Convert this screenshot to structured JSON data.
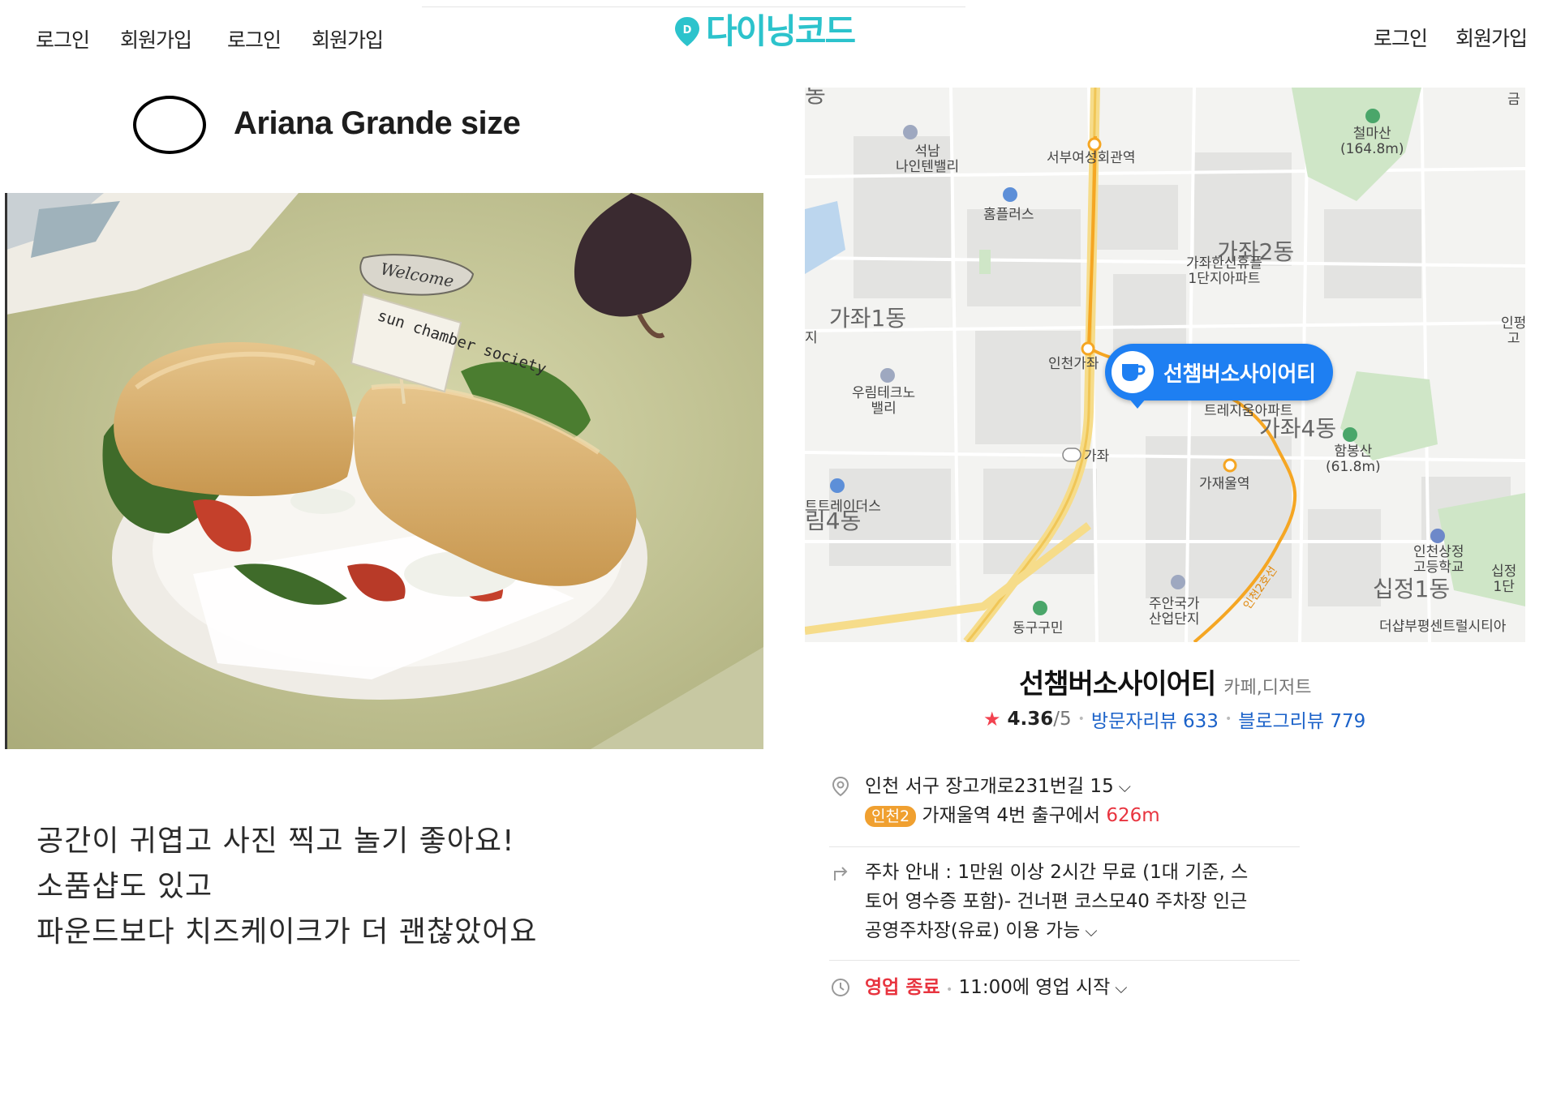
{
  "header": {
    "left_links": [
      "로그인",
      "회원가입",
      "로그인",
      "회원가입"
    ],
    "logo_text": "다이닝코드",
    "right_links": [
      "로그인",
      "회원가입"
    ]
  },
  "post": {
    "title": "Ariana Grande size",
    "photo_pick_text": "Welcome",
    "photo_flag_text": "sun chamber society",
    "review_lines": [
      "공간이 귀엽고 사진 찍고 놀기 좋아요!",
      "소품샵도 있고",
      "파운드보다 치즈케이크가 더 괜찮았어요"
    ]
  },
  "map": {
    "marker_label": "선챔버소사이어티",
    "labels": {
      "cheolmasan": "철마산",
      "cheolmasan_h": "(164.8m)",
      "seoknam": "석남",
      "nine_valley": "나인텐밸리",
      "seobu": "서부여성회관역",
      "homeplus": "홈플러스",
      "gajwa2": "가좌2동",
      "gajwa_apt": "가좌한신휴플",
      "gajwa_apt2": "1단지아파트",
      "gajwa1": "가좌1동",
      "incheon_gajwa": "인천가좌",
      "woorim": "우림테크노",
      "woorim2": "밸리",
      "trezium": "트레지움아파트",
      "gajwa4": "가좌4동",
      "hambong": "함봉산",
      "hambong_h": "(61.8m)",
      "ic_gajwa": "가좌",
      "gajaeul": "가재울역",
      "trade": "트트레이더스",
      "dong4": "림4동",
      "sangjeong": "인천상정",
      "sangjeong2": "고등학교",
      "sipjeong": "십정1동",
      "juan": "주안국가",
      "juan2": "산업단지",
      "donggu": "동구구민",
      "incheon2_line": "인천2호선",
      "thesharp": "더샵부평센트럴시티아",
      "left_edge": "지",
      "top_left": "동",
      "right_edge": "인펑",
      "right_edge2": "고",
      "right_top": "금",
      "sipjeong_r": "십정",
      "sipjeong_r2": "1단"
    }
  },
  "place": {
    "name": "선챔버소사이어티",
    "category": "카페,디저트",
    "star": "★",
    "rating": "4.36",
    "rating_max": "/5",
    "visitor_reviews": "방문자리뷰 633",
    "blog_reviews": "블로그리뷰 779",
    "address": "인천 서구 장고개로231번길 15",
    "subway_line": "인천2",
    "subway_text": "가재울역 4번 출구에서",
    "subway_distance": "626m",
    "parking_lines": [
      "주차 안내 : 1만원 이상 2시간 무료 (1대 기준, 스",
      "토어 영수증 포함)- 건너편 코스모40 주차장 인근",
      "공영주차장(유료) 이용 가능"
    ],
    "status": "영업 종료",
    "open_time": "11:00에 영업 시작"
  },
  "colors": {
    "logo": "#2cc3cc",
    "marker": "#1e7ff2",
    "link": "#1b62c9",
    "status_red": "#e8343f",
    "subway_badge": "#f0a030"
  }
}
